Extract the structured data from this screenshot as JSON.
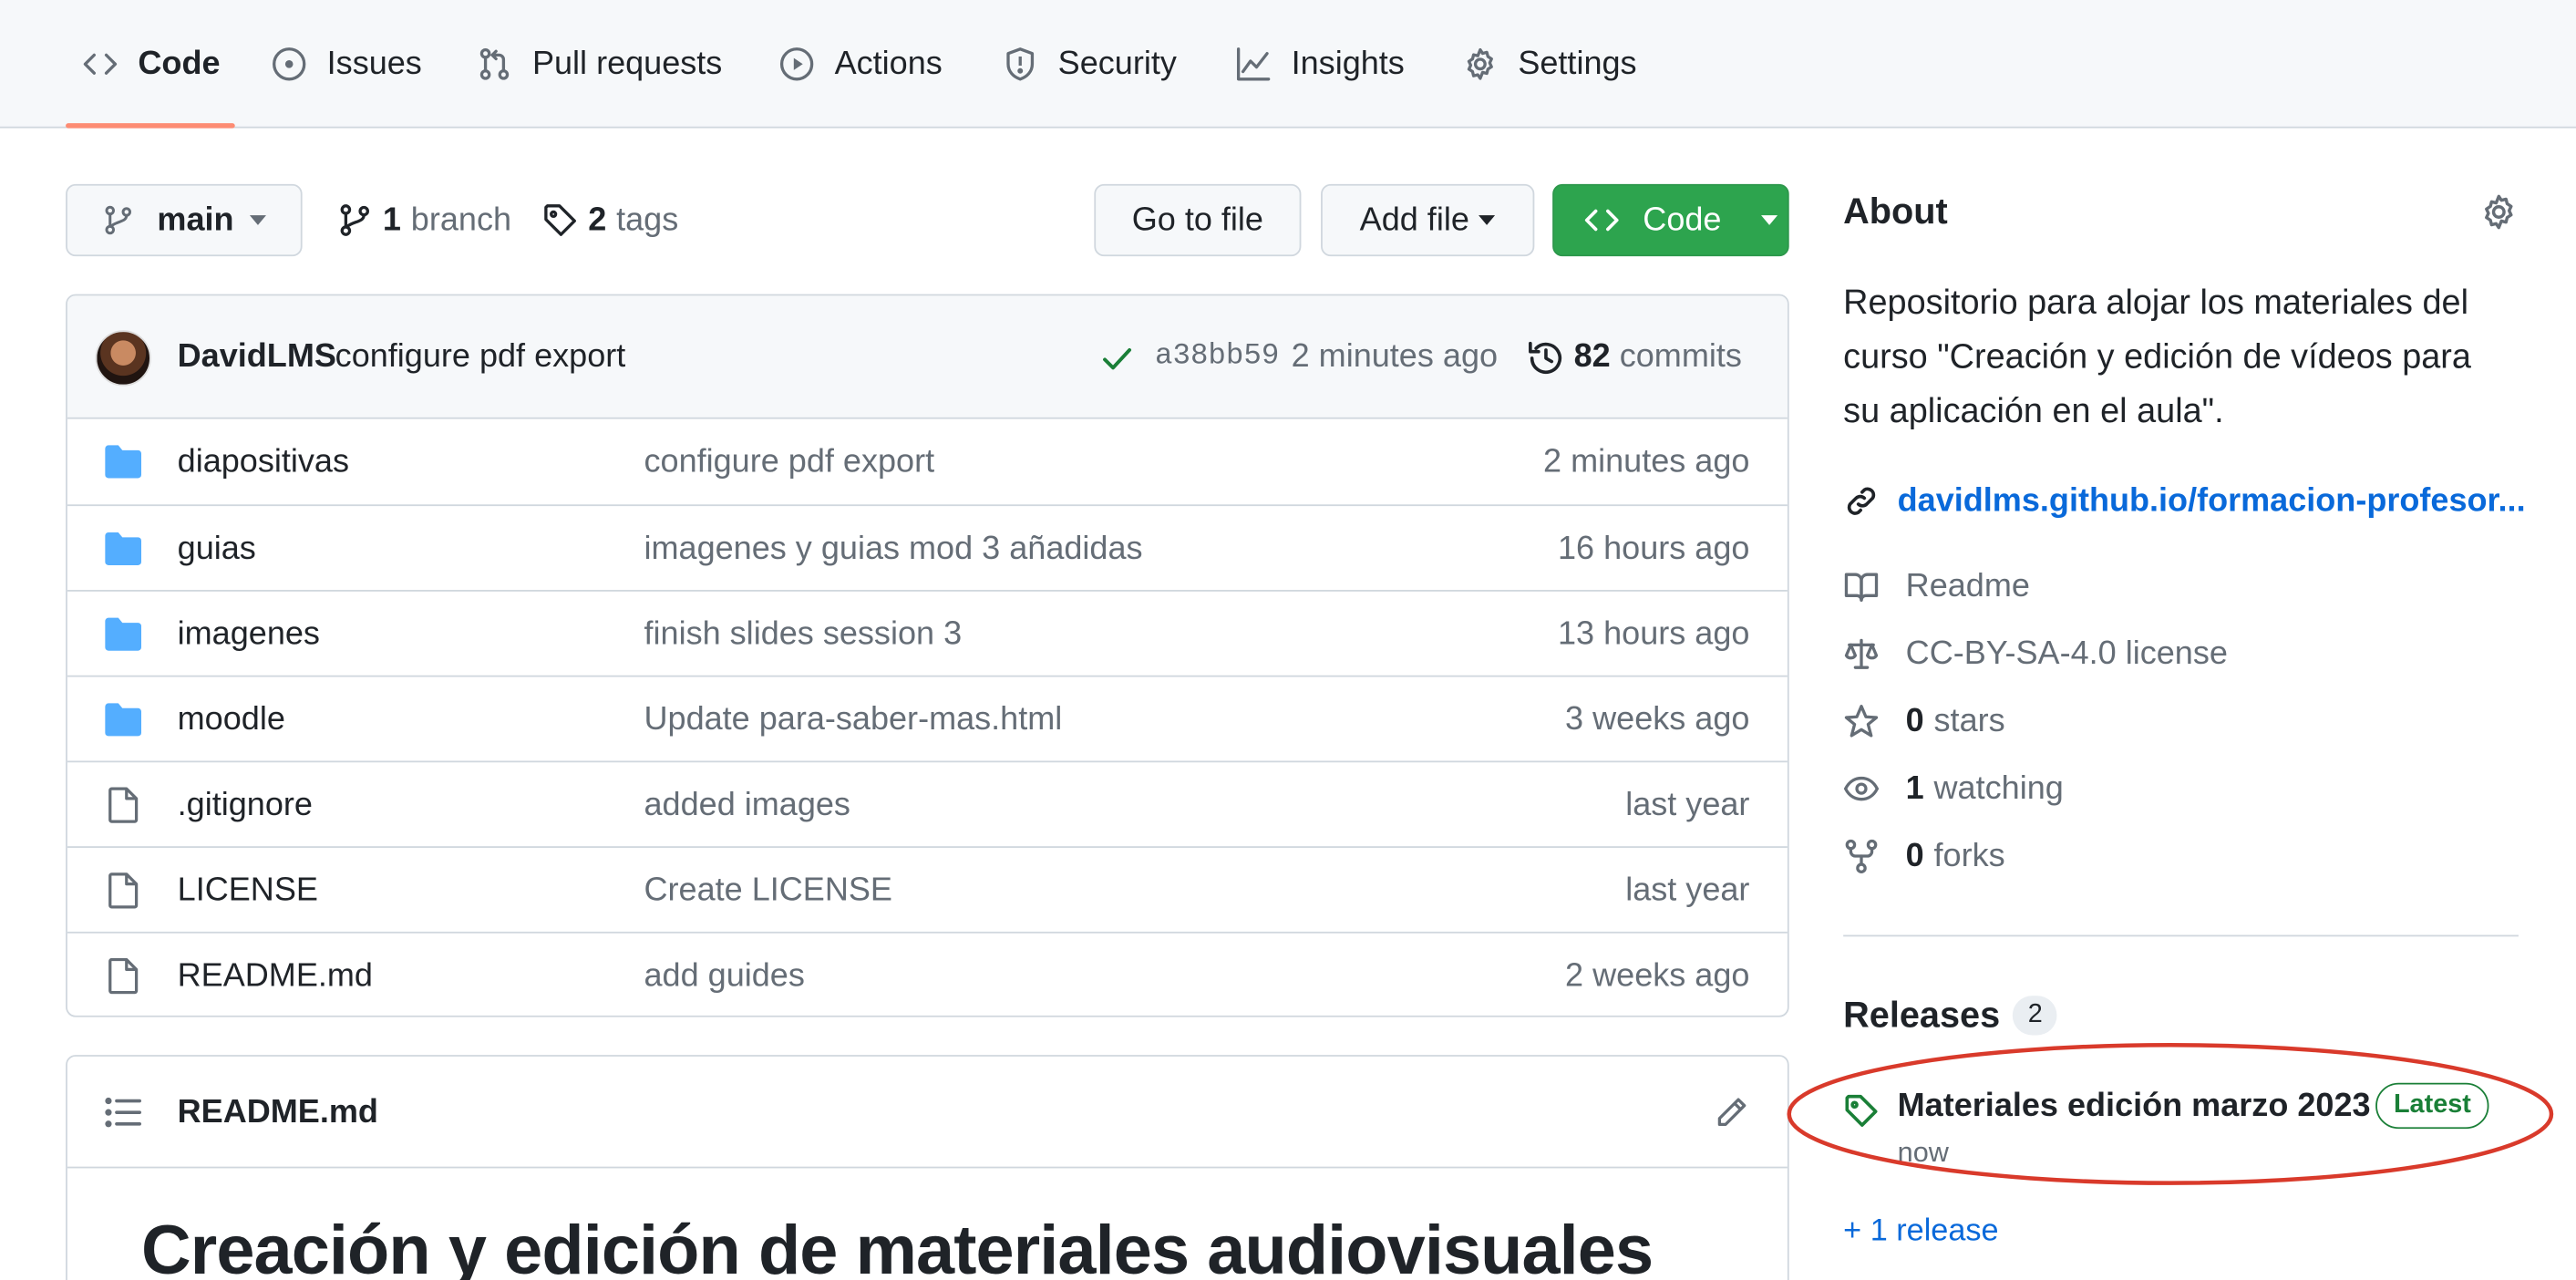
{
  "nav": {
    "tabs": [
      {
        "label": "Code",
        "icon": "code-icon"
      },
      {
        "label": "Issues",
        "icon": "issue-icon"
      },
      {
        "label": "Pull requests",
        "icon": "pull-request-icon"
      },
      {
        "label": "Actions",
        "icon": "play-icon"
      },
      {
        "label": "Security",
        "icon": "shield-icon"
      },
      {
        "label": "Insights",
        "icon": "graph-icon"
      },
      {
        "label": "Settings",
        "icon": "gear-icon"
      }
    ],
    "active": "Code"
  },
  "toolbar": {
    "branch_name": "main",
    "branch_count": "1",
    "branch_label": "branch",
    "tag_count": "2",
    "tag_label": "tags",
    "go_to_file": "Go to file",
    "add_file": "Add file",
    "code": "Code"
  },
  "commit": {
    "author": "DavidLMS",
    "message": "configure pdf export",
    "sha": "a38bb59",
    "time": "2 minutes ago",
    "count": "82",
    "count_label": "commits"
  },
  "files": [
    {
      "name": "diapositivas",
      "type": "folder",
      "message": "configure pdf export",
      "age": "2 minutes ago"
    },
    {
      "name": "guias",
      "type": "folder",
      "message": "imagenes y guias mod 3 añadidas",
      "age": "16 hours ago"
    },
    {
      "name": "imagenes",
      "type": "folder",
      "message": "finish slides session 3",
      "age": "13 hours ago"
    },
    {
      "name": "moodle",
      "type": "folder",
      "message": "Update para-saber-mas.html",
      "age": "3 weeks ago"
    },
    {
      "name": ".gitignore",
      "type": "file",
      "message": "added images",
      "age": "last year"
    },
    {
      "name": "LICENSE",
      "type": "file",
      "message": "Create LICENSE",
      "age": "last year"
    },
    {
      "name": "README.md",
      "type": "file",
      "message": "add guides",
      "age": "2 weeks ago"
    }
  ],
  "readme": {
    "filename": "README.md",
    "heading": "Creación y edición de materiales audiovisuales"
  },
  "about": {
    "title": "About",
    "description_lines": [
      "Repositorio para alojar los materiales del",
      "curso \"Creación y edición de vídeos para",
      "su aplicación en el aula\"."
    ],
    "website": "davidlms.github.io/formacion-profesor...",
    "readme": "Readme",
    "license": "CC-BY-SA-4.0 license",
    "stars_count": "0",
    "stars_label": "stars",
    "watching_count": "1",
    "watching_label": "watching",
    "forks_count": "0",
    "forks_label": "forks"
  },
  "releases": {
    "title": "Releases",
    "count": "2",
    "latest_name": "Materiales edición marzo 2023",
    "latest_badge": "Latest",
    "latest_time": "now",
    "more_link": "+ 1 release"
  },
  "colors": {
    "accent_link": "#0969da",
    "code_button": "#2da44e",
    "tab_underline": "#fd8c73",
    "folder": "#54aeff",
    "annotation_circle": "#d93a2b"
  }
}
